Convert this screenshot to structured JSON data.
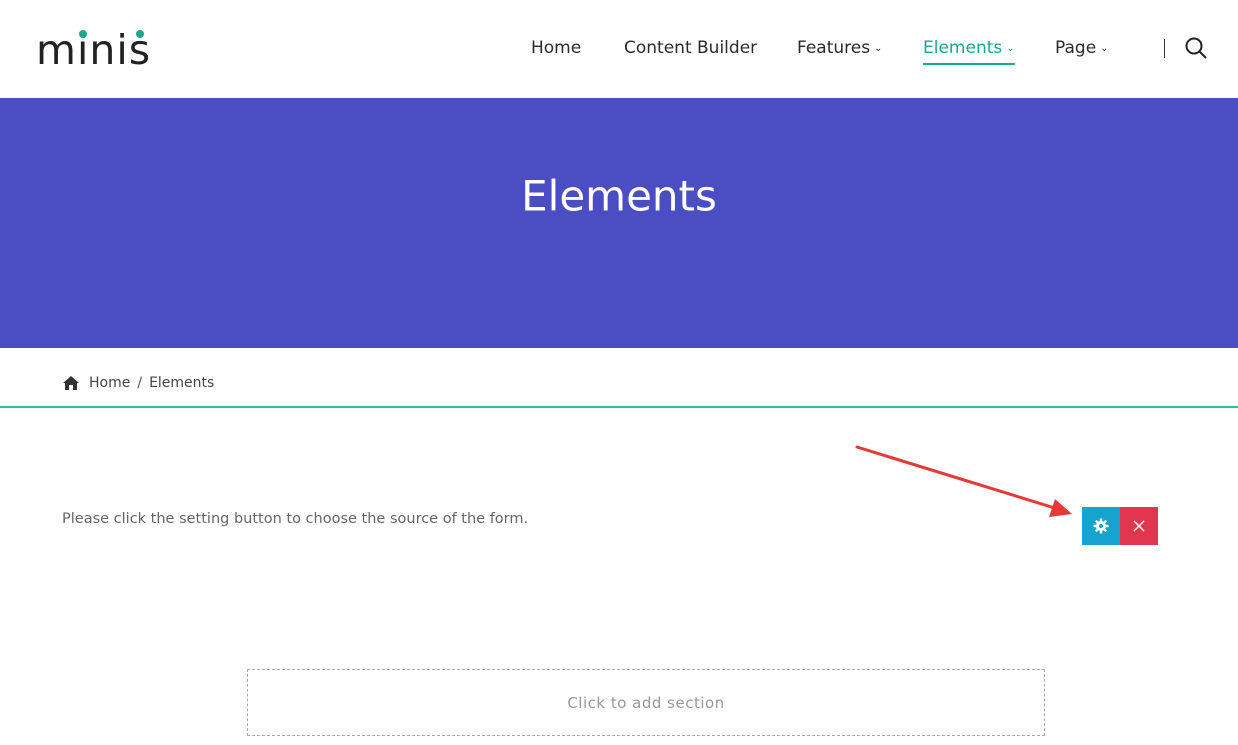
{
  "header": {
    "logo_text": "minis",
    "nav": [
      {
        "label": "Home",
        "has_dropdown": false,
        "active": false
      },
      {
        "label": "Content Builder",
        "has_dropdown": false,
        "active": false
      },
      {
        "label": "Features",
        "has_dropdown": true,
        "active": false
      },
      {
        "label": "Elements",
        "has_dropdown": true,
        "active": true
      },
      {
        "label": "Page",
        "has_dropdown": true,
        "active": false
      }
    ],
    "search_icon": "search-icon"
  },
  "hero": {
    "title": "Elements",
    "background_color": "#4b4dc3"
  },
  "breadcrumb": {
    "home_icon": "home-icon",
    "home_label": "Home",
    "separator": "/",
    "current": "Elements"
  },
  "content": {
    "notice": "Please click the setting button to choose the source of the form.",
    "settings_icon": "gear-icon",
    "remove_icon": "close-icon",
    "add_section_label": "Click to add section"
  },
  "colors": {
    "accent": "#1aa88f",
    "settings_button": "#17a3cf",
    "remove_button": "#e0364f",
    "annotation_arrow": "#e53935"
  }
}
